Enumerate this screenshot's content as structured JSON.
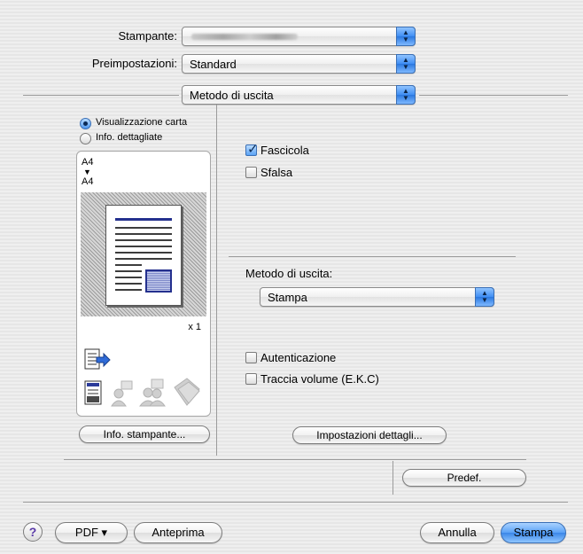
{
  "header": {
    "printer_label": "Stampante:",
    "presets_label": "Preimpostazioni:",
    "presets_value": "Standard",
    "panel_value": "Metodo di uscita"
  },
  "preview": {
    "radio_paper": "Visualizzazione carta",
    "radio_details": "Info. dettagliate",
    "size_from": "A4",
    "size_arrow": "▼",
    "size_to": "A4",
    "copies": "x 1",
    "printer_info_button": "Info. stampante..."
  },
  "options": {
    "collate_label": "Fascicola",
    "collate_checked": true,
    "offset_label": "Sfalsa",
    "offset_checked": false,
    "output_method_label": "Metodo di uscita:",
    "output_method_value": "Stampa",
    "auth_label": "Autenticazione",
    "auth_checked": false,
    "tracking_label": "Traccia volume (E.K.C)",
    "tracking_checked": false,
    "detail_settings_button": "Impostazioni dettagli...",
    "default_button": "Predef."
  },
  "footer": {
    "help": "?",
    "pdf_button": "PDF ▾",
    "preview_button": "Anteprima",
    "cancel_button": "Annulla",
    "print_button": "Stampa"
  },
  "colors": {
    "accent": "#3b86e8",
    "window_bg": "#ececec"
  }
}
